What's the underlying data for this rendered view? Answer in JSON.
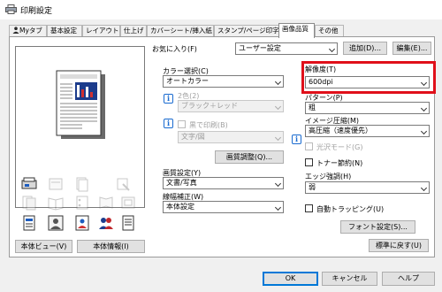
{
  "window": {
    "title": "印刷設定"
  },
  "tabs": [
    "Myタブ",
    "基本設定",
    "レイアウト",
    "仕上げ",
    "カバーシート/挿入紙",
    "スタンプ/ページ印字",
    "画像品質",
    "その他"
  ],
  "active_tab": "画像品質",
  "favorites": {
    "label": "お気に入り(F)",
    "value": "ユーザー設定",
    "add_button": "追加(D)...",
    "edit_button": "編集(E)..."
  },
  "color": {
    "label": "カラー選択(C)",
    "value": "オートカラー",
    "two_color_label": "2色(2)",
    "two_color_value": "ブラック＋レッド",
    "black_print_label": "黒で印刷(B)",
    "black_print_value": "文字/図"
  },
  "quality_adjust_button": "画質調整(Q)...",
  "image_setting": {
    "label": "画質設定(Y)",
    "value": "文書/写真"
  },
  "line_correction": {
    "label": "線幅補正(W)",
    "value": "本体設定"
  },
  "resolution": {
    "label": "解像度(T)",
    "value": "600dpi"
  },
  "pattern": {
    "label": "パターン(P)",
    "value": "粗"
  },
  "compression": {
    "label": "イメージ圧縮(M)",
    "value": "高圧縮（速度優先）"
  },
  "gloss": {
    "label": "光沢モード(G)"
  },
  "toner_save": {
    "label": "トナー節約(N)"
  },
  "edge_enhance": {
    "label": "エッジ強調(H)",
    "value": "弱"
  },
  "auto_trapping": {
    "label": "自動トラッピング(U)"
  },
  "font_settings_button": "フォント設定(S)...",
  "restore_defaults_button": "標準に戻す(U)",
  "left_buttons": {
    "view": "本体ビュー(V)",
    "info": "本体情報(I)"
  },
  "footer": {
    "ok": "OK",
    "cancel": "キャンセル",
    "help": "ヘルプ"
  }
}
